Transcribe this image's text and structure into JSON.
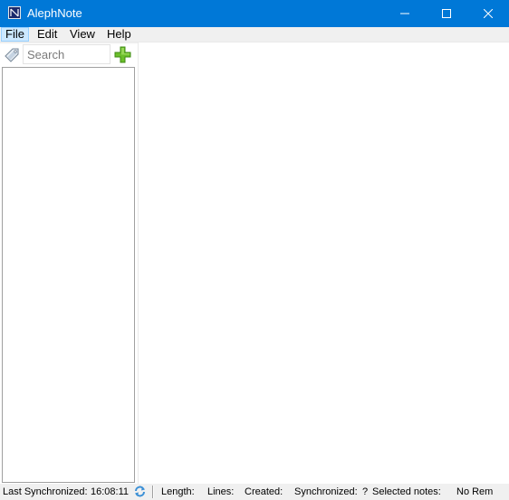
{
  "window": {
    "title": "AlephNote"
  },
  "menu": {
    "items": [
      "File",
      "Edit",
      "View",
      "Help"
    ]
  },
  "sidebar": {
    "search": {
      "placeholder": "Search",
      "value": ""
    },
    "icons": {
      "tag": "tag-icon",
      "add": "add-note-icon"
    }
  },
  "status": {
    "last_sync_label": "Last Synchronized:",
    "last_sync_time": "16:08:11",
    "length_label": "Length:",
    "lines_label": "Lines:",
    "created_label": "Created:",
    "synchronized_label": "Synchronized:",
    "synchronized_value": "?",
    "selected_notes_label": "Selected notes:",
    "remote_label": "No Rem"
  },
  "colors": {
    "titlebar": "#0078d7",
    "add_icon": "#6bbf2a",
    "sync_icon": "#3a8fd6"
  }
}
